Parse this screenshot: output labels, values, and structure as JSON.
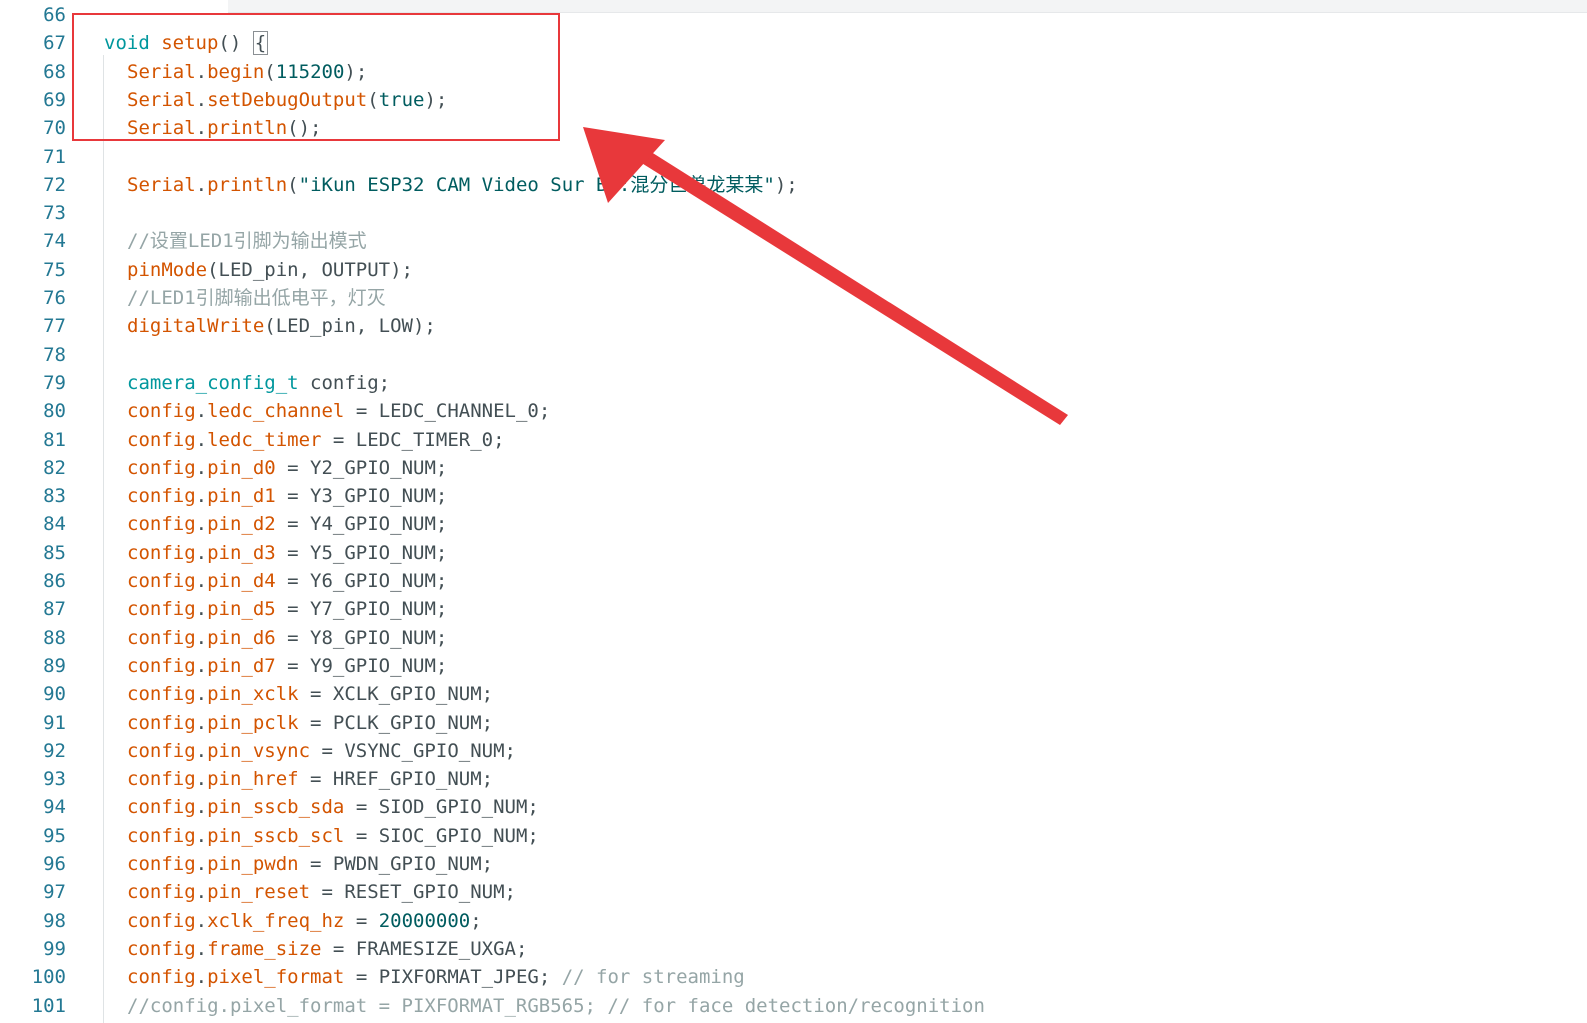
{
  "editor": {
    "accent_color": "#e8383b",
    "lines": [
      {
        "n": "66",
        "tokens": []
      },
      {
        "n": "67",
        "indent": false,
        "tokens": [
          {
            "t": "void",
            "c": "kw"
          },
          {
            "t": " ",
            "c": "id"
          },
          {
            "t": "setup",
            "c": "fn"
          },
          {
            "t": "() ",
            "c": "id"
          },
          {
            "t": "{",
            "c": "id",
            "box": true
          }
        ]
      },
      {
        "n": "68",
        "indent": true,
        "tokens": [
          {
            "t": "Serial",
            "c": "fn"
          },
          {
            "t": ".",
            "c": "id"
          },
          {
            "t": "begin",
            "c": "fn"
          },
          {
            "t": "(",
            "c": "id"
          },
          {
            "t": "115200",
            "c": "nm"
          },
          {
            "t": ");",
            "c": "id"
          }
        ]
      },
      {
        "n": "69",
        "indent": true,
        "tokens": [
          {
            "t": "Serial",
            "c": "fn"
          },
          {
            "t": ".",
            "c": "id"
          },
          {
            "t": "setDebugOutput",
            "c": "fn"
          },
          {
            "t": "(",
            "c": "id"
          },
          {
            "t": "true",
            "c": "nm"
          },
          {
            "t": ");",
            "c": "id"
          }
        ]
      },
      {
        "n": "70",
        "indent": true,
        "tokens": [
          {
            "t": "Serial",
            "c": "fn"
          },
          {
            "t": ".",
            "c": "id"
          },
          {
            "t": "println",
            "c": "fn"
          },
          {
            "t": "();",
            "c": "id"
          }
        ]
      },
      {
        "n": "71",
        "indent": true,
        "tokens": []
      },
      {
        "n": "72",
        "indent": true,
        "tokens": [
          {
            "t": "Serial",
            "c": "fn"
          },
          {
            "t": ".",
            "c": "id"
          },
          {
            "t": "println",
            "c": "fn"
          },
          {
            "t": "(",
            "c": "id"
          },
          {
            "t": "\"iKun ESP32 CAM Video Sur By:混",
            "c": "st"
          },
          {
            "t": "分",
            "c": "st"
          },
          {
            "t": "巨兽龙某某\"",
            "c": "st"
          },
          {
            "t": ");",
            "c": "id"
          }
        ]
      },
      {
        "n": "73",
        "indent": true,
        "tokens": []
      },
      {
        "n": "74",
        "indent": true,
        "tokens": [
          {
            "t": "//设置LED1引脚为输出模式",
            "c": "cm"
          }
        ]
      },
      {
        "n": "75",
        "indent": true,
        "tokens": [
          {
            "t": "pinMode",
            "c": "fn"
          },
          {
            "t": "(LED_pin, OUTPUT);",
            "c": "id"
          }
        ]
      },
      {
        "n": "76",
        "indent": true,
        "tokens": [
          {
            "t": "//LED1引脚输出低电平，灯灭",
            "c": "cm"
          }
        ]
      },
      {
        "n": "77",
        "indent": true,
        "tokens": [
          {
            "t": "digitalWrite",
            "c": "fn"
          },
          {
            "t": "(LED_pin, LOW);",
            "c": "id"
          }
        ]
      },
      {
        "n": "78",
        "indent": true,
        "tokens": []
      },
      {
        "n": "79",
        "indent": true,
        "tokens": [
          {
            "t": "camera_config_t",
            "c": "ty"
          },
          {
            "t": " config;",
            "c": "id"
          }
        ]
      },
      {
        "n": "80",
        "indent": true,
        "tokens": [
          {
            "t": "config",
            "c": "fn"
          },
          {
            "t": ".",
            "c": "id"
          },
          {
            "t": "ledc_channel",
            "c": "fn"
          },
          {
            "t": " = LEDC_CHANNEL_0;",
            "c": "id"
          }
        ]
      },
      {
        "n": "81",
        "indent": true,
        "tokens": [
          {
            "t": "config",
            "c": "fn"
          },
          {
            "t": ".",
            "c": "id"
          },
          {
            "t": "ledc_timer",
            "c": "fn"
          },
          {
            "t": " = LEDC_TIMER_0;",
            "c": "id"
          }
        ]
      },
      {
        "n": "82",
        "indent": true,
        "tokens": [
          {
            "t": "config",
            "c": "fn"
          },
          {
            "t": ".",
            "c": "id"
          },
          {
            "t": "pin_d0",
            "c": "fn"
          },
          {
            "t": " = Y2_GPIO_NUM;",
            "c": "id"
          }
        ]
      },
      {
        "n": "83",
        "indent": true,
        "tokens": [
          {
            "t": "config",
            "c": "fn"
          },
          {
            "t": ".",
            "c": "id"
          },
          {
            "t": "pin_d1",
            "c": "fn"
          },
          {
            "t": " = Y3_GPIO_NUM;",
            "c": "id"
          }
        ]
      },
      {
        "n": "84",
        "indent": true,
        "tokens": [
          {
            "t": "config",
            "c": "fn"
          },
          {
            "t": ".",
            "c": "id"
          },
          {
            "t": "pin_d2",
            "c": "fn"
          },
          {
            "t": " = Y4_GPIO_NUM;",
            "c": "id"
          }
        ]
      },
      {
        "n": "85",
        "indent": true,
        "tokens": [
          {
            "t": "config",
            "c": "fn"
          },
          {
            "t": ".",
            "c": "id"
          },
          {
            "t": "pin_d3",
            "c": "fn"
          },
          {
            "t": " = Y5_GPIO_NUM;",
            "c": "id"
          }
        ]
      },
      {
        "n": "86",
        "indent": true,
        "tokens": [
          {
            "t": "config",
            "c": "fn"
          },
          {
            "t": ".",
            "c": "id"
          },
          {
            "t": "pin_d4",
            "c": "fn"
          },
          {
            "t": " = Y6_GPIO_NUM;",
            "c": "id"
          }
        ]
      },
      {
        "n": "87",
        "indent": true,
        "tokens": [
          {
            "t": "config",
            "c": "fn"
          },
          {
            "t": ".",
            "c": "id"
          },
          {
            "t": "pin_d5",
            "c": "fn"
          },
          {
            "t": " = Y7_GPIO_NUM;",
            "c": "id"
          }
        ]
      },
      {
        "n": "88",
        "indent": true,
        "tokens": [
          {
            "t": "config",
            "c": "fn"
          },
          {
            "t": ".",
            "c": "id"
          },
          {
            "t": "pin_d6",
            "c": "fn"
          },
          {
            "t": " = Y8_GPIO_NUM;",
            "c": "id"
          }
        ]
      },
      {
        "n": "89",
        "indent": true,
        "tokens": [
          {
            "t": "config",
            "c": "fn"
          },
          {
            "t": ".",
            "c": "id"
          },
          {
            "t": "pin_d7",
            "c": "fn"
          },
          {
            "t": " = Y9_GPIO_NUM;",
            "c": "id"
          }
        ]
      },
      {
        "n": "90",
        "indent": true,
        "tokens": [
          {
            "t": "config",
            "c": "fn"
          },
          {
            "t": ".",
            "c": "id"
          },
          {
            "t": "pin_xclk",
            "c": "fn"
          },
          {
            "t": " = XCLK_GPIO_NUM;",
            "c": "id"
          }
        ]
      },
      {
        "n": "91",
        "indent": true,
        "tokens": [
          {
            "t": "config",
            "c": "fn"
          },
          {
            "t": ".",
            "c": "id"
          },
          {
            "t": "pin_pclk",
            "c": "fn"
          },
          {
            "t": " = PCLK_GPIO_NUM;",
            "c": "id"
          }
        ]
      },
      {
        "n": "92",
        "indent": true,
        "tokens": [
          {
            "t": "config",
            "c": "fn"
          },
          {
            "t": ".",
            "c": "id"
          },
          {
            "t": "pin_vsync",
            "c": "fn"
          },
          {
            "t": " = VSYNC_GPIO_NUM;",
            "c": "id"
          }
        ]
      },
      {
        "n": "93",
        "indent": true,
        "tokens": [
          {
            "t": "config",
            "c": "fn"
          },
          {
            "t": ".",
            "c": "id"
          },
          {
            "t": "pin_href",
            "c": "fn"
          },
          {
            "t": " = HREF_GPIO_NUM;",
            "c": "id"
          }
        ]
      },
      {
        "n": "94",
        "indent": true,
        "tokens": [
          {
            "t": "config",
            "c": "fn"
          },
          {
            "t": ".",
            "c": "id"
          },
          {
            "t": "pin_sscb_sda",
            "c": "fn"
          },
          {
            "t": " = SIOD_GPIO_NUM;",
            "c": "id"
          }
        ]
      },
      {
        "n": "95",
        "indent": true,
        "tokens": [
          {
            "t": "config",
            "c": "fn"
          },
          {
            "t": ".",
            "c": "id"
          },
          {
            "t": "pin_sscb_scl",
            "c": "fn"
          },
          {
            "t": " = SIOC_GPIO_NUM;",
            "c": "id"
          }
        ]
      },
      {
        "n": "96",
        "indent": true,
        "tokens": [
          {
            "t": "config",
            "c": "fn"
          },
          {
            "t": ".",
            "c": "id"
          },
          {
            "t": "pin_pwdn",
            "c": "fn"
          },
          {
            "t": " = PWDN_GPIO_NUM;",
            "c": "id"
          }
        ]
      },
      {
        "n": "97",
        "indent": true,
        "tokens": [
          {
            "t": "config",
            "c": "fn"
          },
          {
            "t": ".",
            "c": "id"
          },
          {
            "t": "pin_reset",
            "c": "fn"
          },
          {
            "t": " = RESET_GPIO_NUM;",
            "c": "id"
          }
        ]
      },
      {
        "n": "98",
        "indent": true,
        "tokens": [
          {
            "t": "config",
            "c": "fn"
          },
          {
            "t": ".",
            "c": "id"
          },
          {
            "t": "xclk_freq_hz",
            "c": "fn"
          },
          {
            "t": " = ",
            "c": "id"
          },
          {
            "t": "20000000",
            "c": "nm"
          },
          {
            "t": ";",
            "c": "id"
          }
        ]
      },
      {
        "n": "99",
        "indent": true,
        "tokens": [
          {
            "t": "config",
            "c": "fn"
          },
          {
            "t": ".",
            "c": "id"
          },
          {
            "t": "frame_size",
            "c": "fn"
          },
          {
            "t": " = FRAMESIZE_UXGA;",
            "c": "id"
          }
        ]
      },
      {
        "n": "100",
        "indent": true,
        "tokens": [
          {
            "t": "config",
            "c": "fn"
          },
          {
            "t": ".",
            "c": "id"
          },
          {
            "t": "pixel_format",
            "c": "fn"
          },
          {
            "t": " = PIXFORMAT_JPEG; ",
            "c": "id"
          },
          {
            "t": "// for streaming",
            "c": "cm"
          }
        ]
      },
      {
        "n": "101",
        "indent": true,
        "tokens": [
          {
            "t": "//config.pixel_format = PIXFORMAT_RGB565; // for face detection/recognition",
            "c": "cm"
          }
        ]
      }
    ]
  }
}
